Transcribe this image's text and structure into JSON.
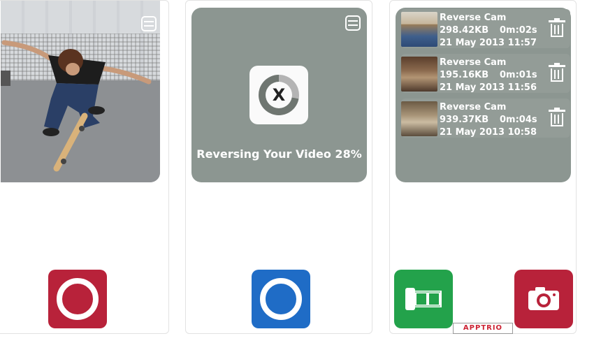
{
  "colors": {
    "record_red": "#b8223a",
    "record_blue": "#1f6cc6",
    "gallery_green": "#23a24b",
    "card_grey": "#8c9691"
  },
  "panel1": {
    "menu_icon": "menu-icon"
  },
  "panel2": {
    "menu_icon": "menu-icon",
    "cancel_symbol": "X",
    "progress_label": "Reversing Your Video 28%",
    "progress_fraction": 0.28
  },
  "panel3": {
    "videos": [
      {
        "title": "Reverse Cam",
        "size": "298.42KB",
        "duration": "0m:02s",
        "date": "21 May 2013 11:57"
      },
      {
        "title": "Reverse Cam",
        "size": "195.16KB",
        "duration": "0m:01s",
        "date": "21 May 2013 11:56"
      },
      {
        "title": "Reverse Cam",
        "size": "939.37KB",
        "duration": "0m:04s",
        "date": "21 May 2013 10:58"
      }
    ],
    "trash_icon": "trash-icon"
  },
  "buttons": {
    "record_icon": "record-icon",
    "gallery_icon": "film-roll-icon",
    "camera_icon": "camera-icon"
  },
  "watermark": "APPTRIO"
}
